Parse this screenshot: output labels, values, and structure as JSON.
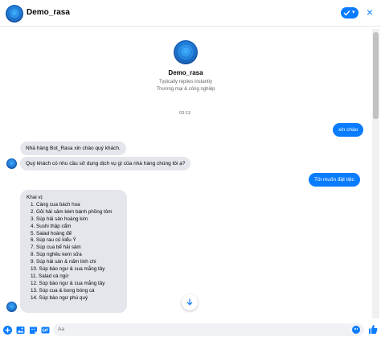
{
  "header": {
    "title": "Demo_rasa",
    "close_glyph": "×"
  },
  "profile": {
    "name": "Demo_rasa",
    "status": "Typically replies instantly",
    "category": "Thương mại & công nghiệp"
  },
  "timestamp": "03:13",
  "messages": {
    "out1": "xin chào",
    "in1": "Nhà hàng Bot_Rasa xin chào quý khách.",
    "in2": "Quý khách có nhu cầu sử dụng dịch vụ gì của nhà hàng chúng tôi ạ?",
    "out2": "Tôi muốn đặt tiệc"
  },
  "menu_list": {
    "heading": "Khai vị:",
    "items": [
      "1. Càng cua bách hoa",
      "2. Gỏi hải sâm kèm bánh phồng tôm",
      "3. Súp hải sản hoàng kim",
      "4. Sushi thập cẩm",
      "5. Salad hoàng đế",
      "6. Súp rau củ kiểu Ý",
      "7. Súp cua bể hải sâm",
      "8. Súp nghêu kem sữa",
      "9. Súp hải sản & nấm linh chi",
      "10. Súp bào ngư & cua mắng tây",
      "11. Salad cá ngừ",
      "12. Súp bào ngư & cua mắng tây",
      "13. Súp cua & bong bóng cá",
      "14. Súp bào ngư phú quý"
    ]
  },
  "composer": {
    "placeholder": "Aa"
  },
  "colors": {
    "accent": "#0a7cff",
    "bubble_in": "#e4e6eb",
    "muted": "#65676b"
  },
  "icons": [
    "plus-icon",
    "image-icon",
    "sticker-icon",
    "gif-icon",
    "emoji-icon",
    "like-icon",
    "chevron-down-icon",
    "check-icon",
    "close-icon"
  ]
}
